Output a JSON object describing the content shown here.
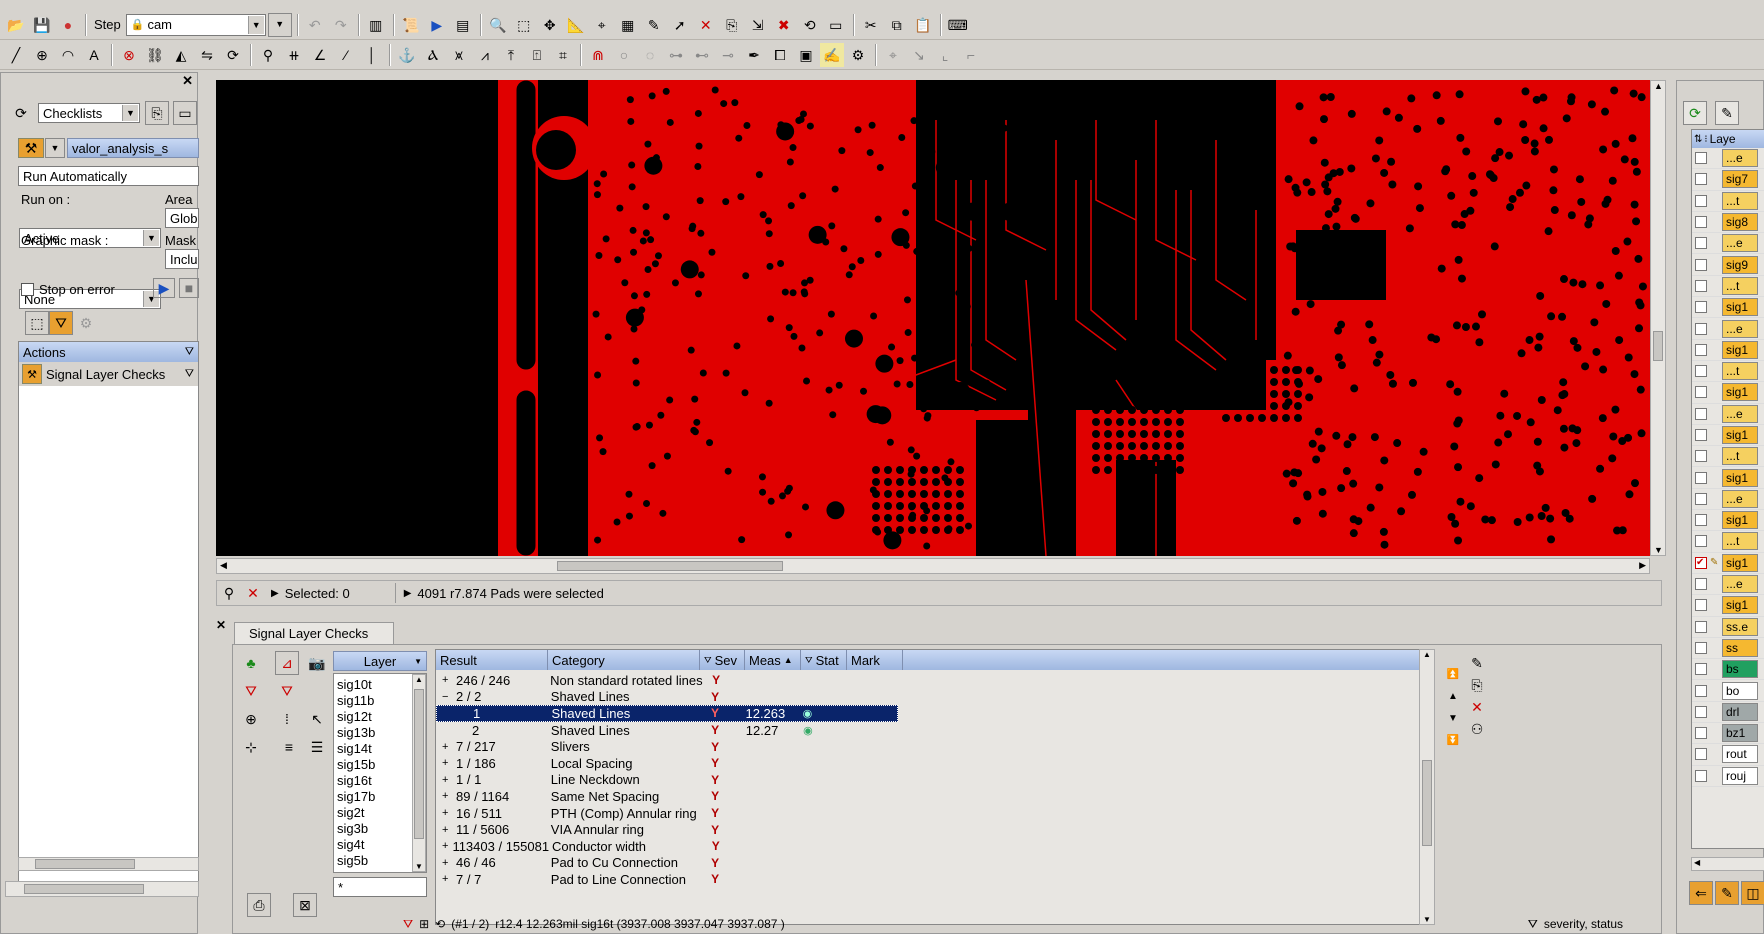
{
  "toolbar": {
    "step_label": "Step",
    "step_value": "cam"
  },
  "left": {
    "mode_select": "Checklists",
    "checklist_name": "valor_analysis_s",
    "run_mode": "Run Automatically",
    "run_on_label": "Run on :",
    "run_on_value": "Active",
    "area_label": "Area r",
    "area_value": "Globa",
    "graphic_mask_label": "Graphic mask :",
    "graphic_mask_value": "None",
    "mask_label": "Mask",
    "mask_value": "Incluc",
    "stop_on_error": "Stop on error",
    "actions_label": "Actions",
    "action_item": "Signal Layer Checks"
  },
  "status_strip": {
    "selected": "Selected: 0",
    "message": "4091 r7.874 Pads were selected"
  },
  "results": {
    "tab": "Signal Layer Checks",
    "layer_header": "Layer",
    "layers": [
      "sig10t",
      "sig11b",
      "sig12t",
      "sig13b",
      "sig14t",
      "sig15b",
      "sig16t",
      "sig17b",
      "sig2t",
      "sig3b",
      "sig4t",
      "sig5b"
    ],
    "layer_filter": "*",
    "columns": [
      "Result",
      "Category",
      "Sev",
      "Meas",
      "Stat",
      "Mark"
    ],
    "rows": [
      {
        "result": "246 / 246",
        "category": "Non standard rotated lines",
        "meas": "",
        "level": 0,
        "expander": "+"
      },
      {
        "result": "2 / 2",
        "category": "Shaved Lines",
        "meas": "",
        "level": 0,
        "expander": "−"
      },
      {
        "result": "1",
        "category": "Shaved Lines",
        "meas": "12.263",
        "level": 1,
        "expander": "",
        "selected": true
      },
      {
        "result": "2",
        "category": "Shaved Lines",
        "meas": "12.27",
        "level": 1,
        "expander": ""
      },
      {
        "result": "7 / 217",
        "category": "Slivers",
        "meas": "",
        "level": 0,
        "expander": "+"
      },
      {
        "result": "1 / 186",
        "category": "Local Spacing",
        "meas": "",
        "level": 0,
        "expander": "+"
      },
      {
        "result": "1 / 1",
        "category": "Line Neckdown",
        "meas": "",
        "level": 0,
        "expander": "+"
      },
      {
        "result": "89 / 1164",
        "category": "Same Net Spacing",
        "meas": "",
        "level": 0,
        "expander": "+"
      },
      {
        "result": "16 / 511",
        "category": "PTH (Comp) Annular ring",
        "meas": "",
        "level": 0,
        "expander": "+"
      },
      {
        "result": "11 / 5606",
        "category": "VIA Annular ring",
        "meas": "",
        "level": 0,
        "expander": "+"
      },
      {
        "result": "113403 / 155081",
        "category": "Conductor width",
        "meas": "",
        "level": 0,
        "expander": "+"
      },
      {
        "result": "46 / 46",
        "category": "Pad to Cu Connection",
        "meas": "",
        "level": 0,
        "expander": "+"
      },
      {
        "result": "7 / 7",
        "category": "Pad to Line Connection",
        "meas": "",
        "level": 0,
        "expander": "+"
      }
    ],
    "status_count": "(#1 / 2)",
    "status_detail": "r12.4   12.263mil  sig16t (3937.008 3937.047 3937.087 )",
    "status_sort": "severity, status"
  },
  "right": {
    "layer_header": "Laye",
    "layers": [
      {
        "name": "...e",
        "color": "#f5d060",
        "checked": false
      },
      {
        "name": "sig7",
        "color": "#f5b830",
        "checked": false
      },
      {
        "name": "...t",
        "color": "#f5d060",
        "checked": false
      },
      {
        "name": "sig8",
        "color": "#f5b830",
        "checked": false
      },
      {
        "name": "...e",
        "color": "#f5d060",
        "checked": false
      },
      {
        "name": "sig9",
        "color": "#f5b830",
        "checked": false
      },
      {
        "name": "...t",
        "color": "#f5d060",
        "checked": false
      },
      {
        "name": "sig1",
        "color": "#f5b830",
        "checked": false
      },
      {
        "name": "...e",
        "color": "#f5d060",
        "checked": false
      },
      {
        "name": "sig1",
        "color": "#f5b830",
        "checked": false
      },
      {
        "name": "...t",
        "color": "#f5d060",
        "checked": false
      },
      {
        "name": "sig1",
        "color": "#f5b830",
        "checked": false
      },
      {
        "name": "...e",
        "color": "#f5d060",
        "checked": false
      },
      {
        "name": "sig1",
        "color": "#f5b830",
        "checked": false
      },
      {
        "name": "...t",
        "color": "#f5d060",
        "checked": false
      },
      {
        "name": "sig1",
        "color": "#f5b830",
        "checked": false
      },
      {
        "name": "...e",
        "color": "#f5d060",
        "checked": false
      },
      {
        "name": "sig1",
        "color": "#f5b830",
        "checked": false
      },
      {
        "name": "...t",
        "color": "#f5d060",
        "checked": false
      },
      {
        "name": "sig1",
        "color": "#f5b830",
        "checked": true
      },
      {
        "name": "...e",
        "color": "#f5d060",
        "checked": false
      },
      {
        "name": "sig1",
        "color": "#f5b830",
        "checked": false
      },
      {
        "name": "ss.e",
        "color": "#f5d060",
        "checked": false
      },
      {
        "name": "ss",
        "color": "#f5b830",
        "checked": false
      },
      {
        "name": "bs",
        "color": "#20a060",
        "checked": false
      },
      {
        "name": "bo",
        "color": "#ffffff",
        "checked": false
      },
      {
        "name": "drl",
        "color": "#a0a8a8",
        "checked": false
      },
      {
        "name": "bz1",
        "color": "#a0a8a8",
        "checked": false
      },
      {
        "name": "rout",
        "color": "#ffffff",
        "checked": false
      },
      {
        "name": "rouj",
        "color": "#ffffff",
        "checked": false
      }
    ]
  }
}
